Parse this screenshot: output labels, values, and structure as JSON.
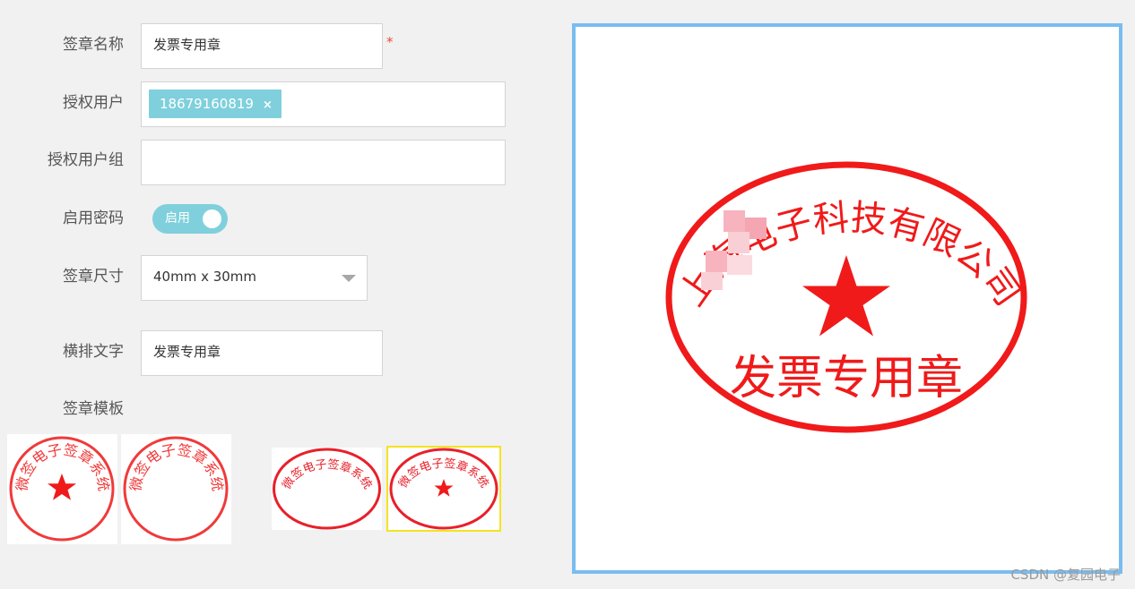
{
  "form": {
    "seal_name": {
      "label": "签章名称",
      "value": "发票专用章",
      "required_mark": "*"
    },
    "auth_user": {
      "label": "授权用户",
      "tag": "18679160819",
      "tag_remove": "×"
    },
    "auth_group": {
      "label": "授权用户组",
      "value": ""
    },
    "password": {
      "label": "启用密码",
      "toggle_text": "启用",
      "enabled": true
    },
    "size": {
      "label": "签章尺寸",
      "selected": "40mm x 30mm"
    },
    "horizontal_text": {
      "label": "横排文字",
      "value": "发票专用章"
    },
    "templates": {
      "label": "签章模板",
      "items": [
        {
          "arc_text": "微签电子签章系统",
          "star": true,
          "shape": "circle"
        },
        {
          "arc_text": "微签电子签章系统",
          "star": false,
          "shape": "circle"
        },
        {
          "arc_text": "微签电子签章系统",
          "star": false,
          "shape": "ellipse"
        },
        {
          "arc_text": "微签电子签章系统",
          "star": true,
          "shape": "ellipse",
          "selected": true
        }
      ]
    }
  },
  "preview": {
    "arc_text": "上海电子科技有限公司",
    "center_text": "发票专用章",
    "ink_color": "#f01a1a"
  },
  "watermark": "CSDN @复园电子",
  "colors": {
    "accent": "#7fd0dc",
    "preview_border": "#79bdf0",
    "selected_border": "#f4e320",
    "required": "#e74c3c"
  }
}
